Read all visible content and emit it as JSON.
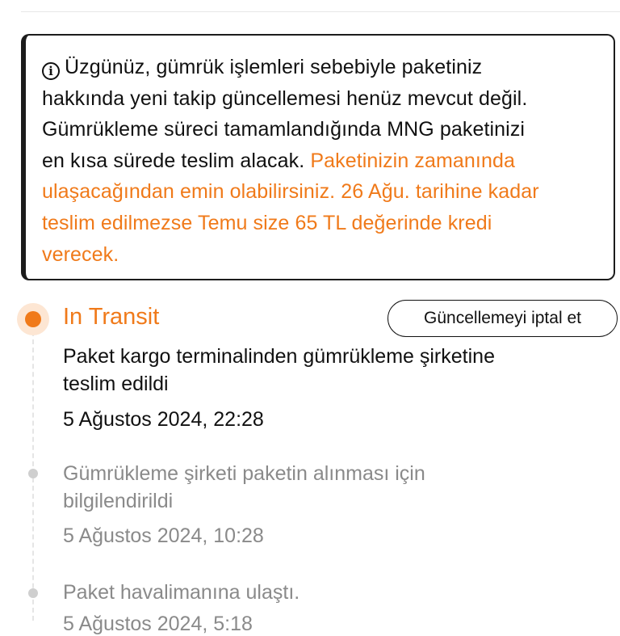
{
  "notice": {
    "icon": "info-icon",
    "lines_black": [
      "Üzgünüz, gümrük işlemleri sebebiyle paketiniz",
      "hakkında yeni takip güncellemesi henüz mevcut değil.",
      "Gümrükleme süreci tamamlandığında MNG paketinizi",
      "en kısa sürede teslim alacak. "
    ],
    "orange_inline": "Paketinizin zamanında",
    "lines_orange": [
      "ulaşacağından emin olabilirsiniz. 26 Ağu. tarihine kadar",
      "teslim edilmezse Temu size 65 TL değerinde kredi",
      "verecek."
    ]
  },
  "timeline": {
    "current": {
      "status": "In Transit",
      "cancel_label": "Güncellemeyi iptal et",
      "lines": [
        "Paket kargo terminalinden gümrükleme şirketine",
        "teslim edildi"
      ],
      "date": "5 Ağustos 2024, 22:28"
    },
    "events": [
      {
        "lines": [
          "Gümrükleme şirketi paketin alınması için",
          "bilgilendirildi"
        ],
        "date": "5 Ağustos 2024, 10:28"
      },
      {
        "lines": [
          "Paket havalimanına ulaştı."
        ],
        "date": "5 Ağustos 2024, 5:18"
      }
    ]
  },
  "colors": {
    "accent": "#f07a1a",
    "muted": "#8a8a8a",
    "text": "#111111"
  }
}
